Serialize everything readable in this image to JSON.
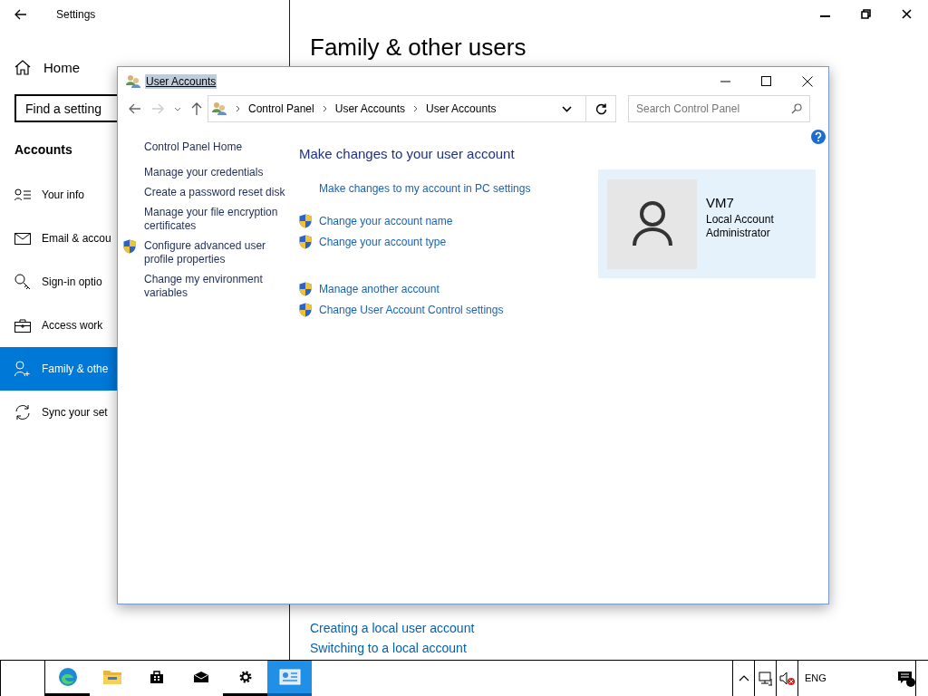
{
  "settings": {
    "title": "Settings",
    "home": "Home",
    "search": {
      "placeholder": "Find a setting"
    },
    "section": "Accounts",
    "nav": [
      {
        "kind": "info",
        "label": "Your info",
        "selected": false
      },
      {
        "kind": "mail",
        "label": "Email & accou",
        "selected": false
      },
      {
        "kind": "key",
        "label": "Sign-in optio",
        "selected": false
      },
      {
        "kind": "briefcase",
        "label": "Access work",
        "selected": false
      },
      {
        "kind": "person",
        "label": "Family & othe",
        "selected": true
      },
      {
        "kind": "sync",
        "label": "Sync your set",
        "selected": false
      }
    ],
    "page_title": "Family & other users",
    "links": [
      "Creating a local user account",
      "Switching to a local account"
    ]
  },
  "dialog": {
    "title": "User Accounts",
    "title_highlighted": true,
    "breadcrumb": [
      "Control Panel",
      "User Accounts",
      "User Accounts"
    ],
    "search": {
      "placeholder": "Search Control Panel"
    },
    "side_groups": [
      [
        {
          "label": "Control Panel Home",
          "shield": false
        }
      ],
      [
        {
          "label": "Manage your credentials",
          "shield": false
        },
        {
          "label": "Create a password reset disk",
          "shield": false
        },
        {
          "label": "Manage your file encryption certificates",
          "shield": false
        },
        {
          "label": "Configure advanced user profile properties",
          "shield": true
        },
        {
          "label": "Change my environment variables",
          "shield": false
        }
      ]
    ],
    "heading": "Make changes to your user account",
    "link_groups": [
      [
        {
          "label": "Make changes to my account in PC settings",
          "shield": false
        }
      ],
      [
        {
          "label": "Change your account name",
          "shield": true
        },
        {
          "label": "Change your account type",
          "shield": true
        }
      ],
      [
        {
          "label": "Manage another account",
          "shield": true
        },
        {
          "label": "Change User Account Control settings",
          "shield": true
        }
      ]
    ],
    "account": {
      "name": "VM7",
      "type": "Local Account",
      "role": "Administrator"
    }
  },
  "taskbar": {
    "apps": [
      {
        "kind": "edge",
        "running": true,
        "selected": false
      },
      {
        "kind": "folder",
        "running": false,
        "selected": false
      },
      {
        "kind": "store",
        "running": false,
        "selected": false
      },
      {
        "kind": "mail",
        "running": false,
        "selected": false
      },
      {
        "kind": "gear",
        "running": true,
        "selected": false
      },
      {
        "kind": "control-panel",
        "running": true,
        "selected": true
      }
    ],
    "language": "ENG"
  }
}
